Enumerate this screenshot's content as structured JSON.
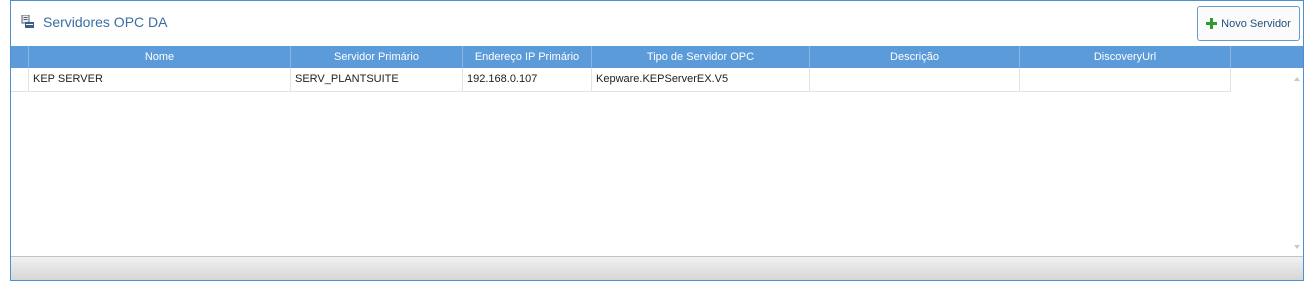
{
  "header": {
    "title": "Servidores OPC DA",
    "new_button_label": "Novo Servidor"
  },
  "grid": {
    "columns": [
      "",
      "Nome",
      "Servidor Primário",
      "Endereço IP Primário",
      "Tipo de Servidor OPC",
      "Descrição",
      "DiscoveryUrl"
    ],
    "rows": [
      {
        "selector": "",
        "nome": "KEP SERVER",
        "servidor_primario": "SERV_PLANTSUITE",
        "endereco_ip": "192.168.0.107",
        "tipo": "Kepware.KEPServerEX.V5",
        "descricao": "",
        "discovery_url": ""
      }
    ]
  },
  "colors": {
    "header_bg": "#5b9bd9",
    "title_text": "#3a6ea5",
    "add_icon": "#2f9b2f"
  },
  "icons": [
    "opc-server-icon",
    "plus-icon",
    "scroll-up-icon",
    "scroll-down-icon"
  ]
}
